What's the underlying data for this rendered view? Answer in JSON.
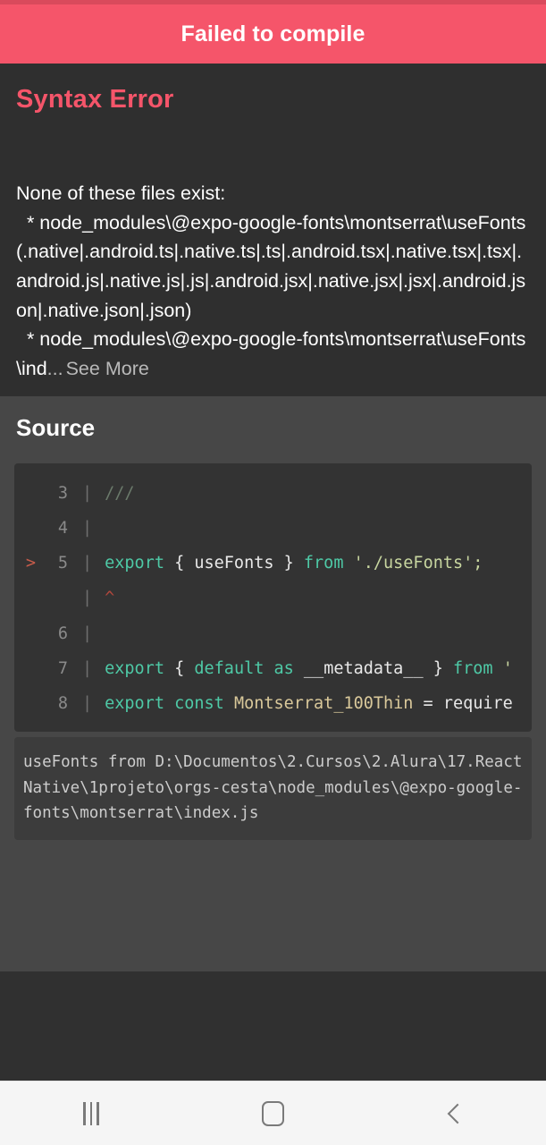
{
  "header": {
    "title": "Failed to compile"
  },
  "error": {
    "kind": "Syntax Error",
    "message": "None of these files exist:\n  * node_modules\\@expo-google-fonts\\montserrat\\useFonts(.native|.android.ts|.native.ts|.ts|.android.tsx|.native.tsx|.tsx|.android.js|.native.js|.js|.android.jsx|.native.jsx|.jsx|.android.json|.native.json|.json)\n  * node_modules\\@expo-google-fonts\\montserrat\\useFonts\\ind",
    "truncation": "...",
    "see_more_label": "See More"
  },
  "source": {
    "heading": "Source",
    "lines": [
      {
        "marker": "",
        "number": "3",
        "tokens": [
          {
            "text": "///",
            "type": "comment"
          }
        ]
      },
      {
        "marker": "",
        "number": "4",
        "tokens": []
      },
      {
        "marker": ">",
        "number": "5",
        "tokens": [
          {
            "text": "export ",
            "type": "kw"
          },
          {
            "text": "{ useFonts } ",
            "type": "plain"
          },
          {
            "text": "from ",
            "type": "kw"
          },
          {
            "text": "'./useFonts';",
            "type": "str"
          }
        ]
      },
      {
        "marker": "",
        "number": "",
        "tokens": [
          {
            "text": "                        ^",
            "type": "caret"
          }
        ]
      },
      {
        "marker": "",
        "number": "6",
        "tokens": []
      },
      {
        "marker": "",
        "number": "7",
        "tokens": [
          {
            "text": "export ",
            "type": "kw"
          },
          {
            "text": "{ ",
            "type": "plain"
          },
          {
            "text": "default ",
            "type": "kw"
          },
          {
            "text": "as ",
            "type": "kw"
          },
          {
            "text": "__metadata__ } ",
            "type": "plain"
          },
          {
            "text": "from ",
            "type": "kw"
          },
          {
            "text": "'",
            "type": "str"
          }
        ]
      },
      {
        "marker": "",
        "number": "8",
        "tokens": [
          {
            "text": "export const ",
            "type": "kw"
          },
          {
            "text": "Montserrat_100Thin",
            "type": "fn"
          },
          {
            "text": " = require",
            "type": "plain"
          }
        ]
      }
    ],
    "footer_path": "    useFonts from D:\\Documentos\\2.Cursos\\2.Alura\\17.ReactNative\\1projeto\\orgs-cesta\\node_modules\\@expo-google-fonts\\montserrat\\index.js"
  },
  "nav_bar": {
    "recents_label": "Recents",
    "home_label": "Home",
    "back_label": "Back"
  },
  "colors": {
    "header_red": "#f5556a",
    "error_kind_red": "#f5556a",
    "error_bg": "#2f2f2f",
    "source_bg": "#474747",
    "code_bg": "#333333",
    "keyword": "#4ec9a6",
    "string": "#c8d6a0",
    "function": "#d9c89a",
    "comment": "#6b7a6b",
    "caret": "#b0473c"
  }
}
